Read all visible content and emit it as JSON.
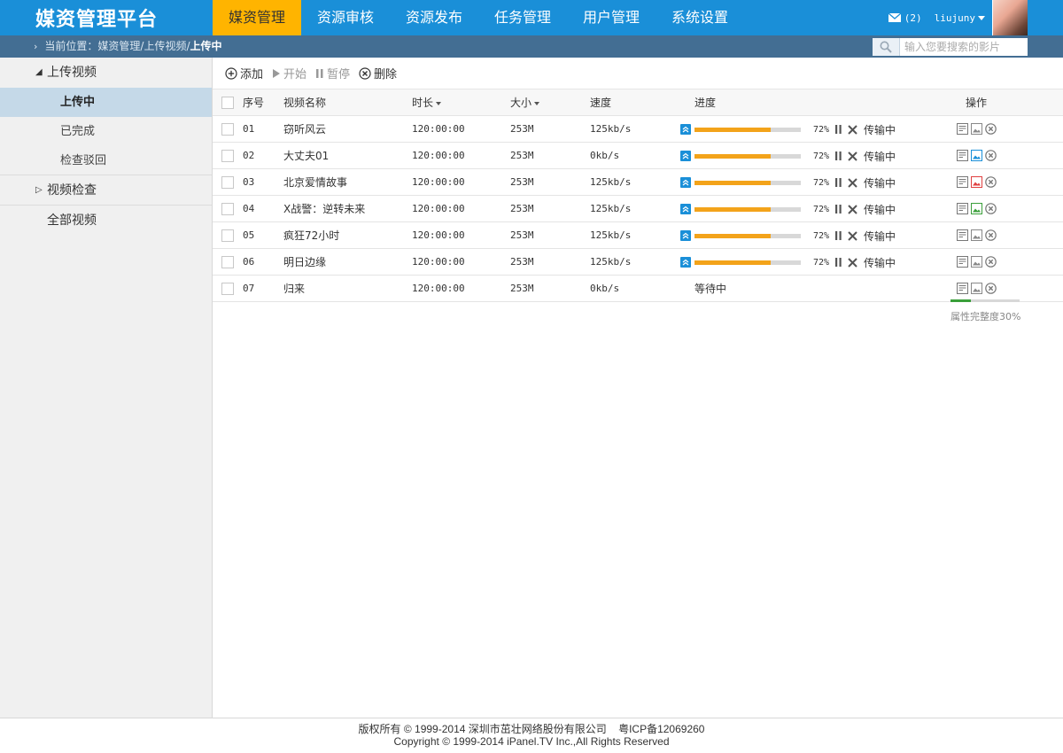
{
  "header": {
    "logo": "媒资管理平台",
    "nav": [
      "媒资管理",
      "资源审核",
      "资源发布",
      "任务管理",
      "用户管理",
      "系统设置"
    ],
    "active_nav": 0,
    "message_count": "(2)",
    "username": "liujuny"
  },
  "breadcrumb": {
    "prefix": "当前位置：媒资管理/上传视频/",
    "current": "上传中"
  },
  "search": {
    "placeholder": "输入您要搜索的影片"
  },
  "sidebar": {
    "groups": [
      {
        "label": "上传视频",
        "expanded": true,
        "items": [
          "上传中",
          "已完成",
          "检查驳回"
        ]
      },
      {
        "label": "视频检查",
        "expanded": false
      },
      {
        "label": "全部视频"
      }
    ],
    "active_item": "上传中"
  },
  "toolbar": {
    "add": "添加",
    "start": "开始",
    "pause": "暂停",
    "delete": "删除"
  },
  "table": {
    "headers": {
      "no": "序号",
      "name": "视频名称",
      "duration": "时长",
      "size": "大小",
      "speed": "速度",
      "progress": "进度",
      "ops": "操作"
    },
    "rows": [
      {
        "no": "01",
        "name": "窃听风云",
        "duration": "120:00:00",
        "size": "253M",
        "speed": "125kb/s",
        "progress": 72,
        "pct": "72%",
        "state": "传输中",
        "image_icon_color": "#888888"
      },
      {
        "no": "02",
        "name": "大丈夫01",
        "duration": "120:00:00",
        "size": "253M",
        "speed": "0kb/s",
        "progress": 72,
        "pct": "72%",
        "state": "传输中",
        "image_icon_color": "#1a8fd8"
      },
      {
        "no": "03",
        "name": "北京爱情故事",
        "duration": "120:00:00",
        "size": "253M",
        "speed": "125kb/s",
        "progress": 72,
        "pct": "72%",
        "state": "传输中",
        "image_icon_color": "#e04040"
      },
      {
        "no": "04",
        "name": "X战警：逆转未来",
        "duration": "120:00:00",
        "size": "253M",
        "speed": "125kb/s",
        "progress": 72,
        "pct": "72%",
        "state": "传输中",
        "image_icon_color": "#3a9f3a"
      },
      {
        "no": "05",
        "name": "疯狂72小时",
        "duration": "120:00:00",
        "size": "253M",
        "speed": "125kb/s",
        "progress": 72,
        "pct": "72%",
        "state": "传输中",
        "image_icon_color": "#888888"
      },
      {
        "no": "06",
        "name": "明日边缘",
        "duration": "120:00:00",
        "size": "253M",
        "speed": "125kb/s",
        "progress": 72,
        "pct": "72%",
        "state": "传输中",
        "image_icon_color": "#888888"
      },
      {
        "no": "07",
        "name": "归来",
        "duration": "120:00:00",
        "size": "253M",
        "speed": "0kb/s",
        "progress": null,
        "pct": "",
        "state": "等待中",
        "image_icon_color": "#888888"
      }
    ]
  },
  "completeness": {
    "label": "属性完整度30%",
    "value": 0.3
  },
  "footer": {
    "line1": "版权所有 © 1999-2014 深圳市茁壮网络股份有限公司    粤ICP备12069260",
    "line2": "Copyright © 1999-2014 iPanel.TV Inc.,All Rights Reserved"
  },
  "colors": {
    "brand_blue": "#1a8fd8",
    "nav_active": "#ffb400",
    "sub_bar": "#436e93",
    "progress": "#f3a31a",
    "completeness": "#3a9f3a"
  }
}
